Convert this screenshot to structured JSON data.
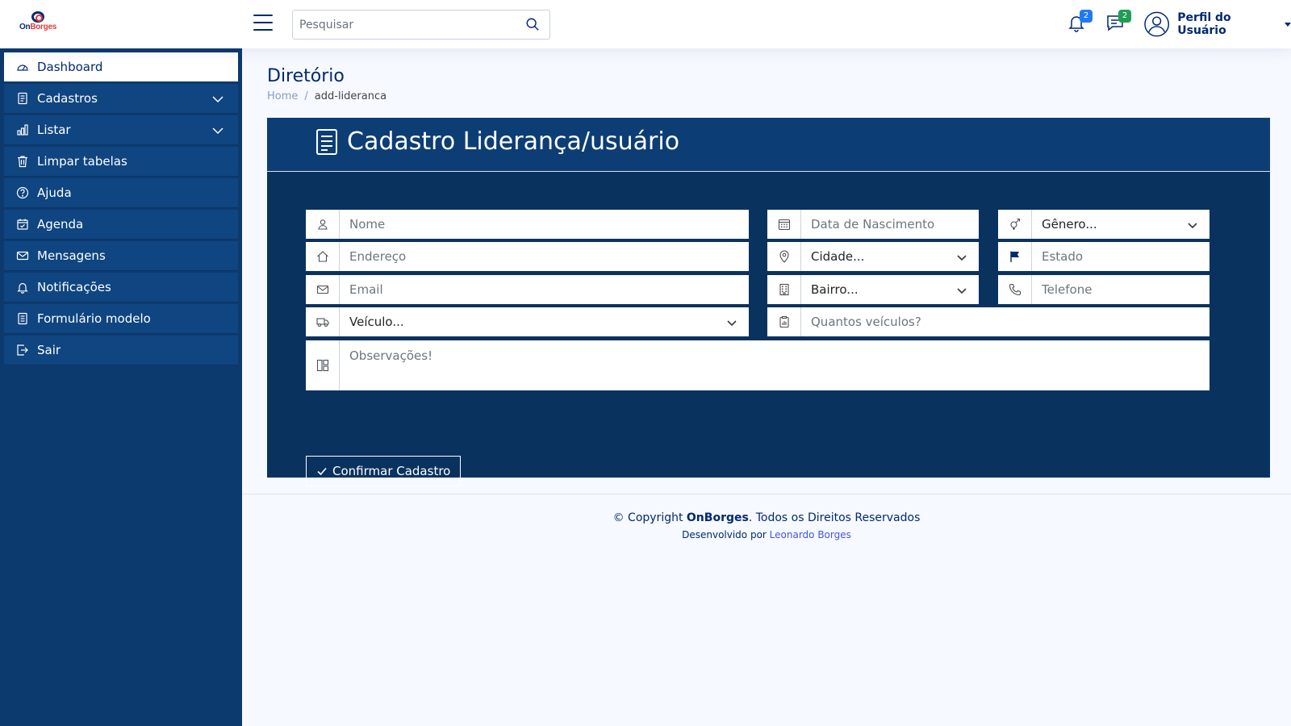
{
  "header": {
    "logo": {
      "brand_on": "On",
      "brand_borges": "Borges"
    },
    "search_placeholder": "Pesquisar",
    "notifications_count": "2",
    "messages_count": "2",
    "profile_label": "Perfil do Usuário"
  },
  "sidebar": {
    "items": [
      {
        "label": "Dashboard",
        "icon": "speedometer-icon"
      },
      {
        "label": "Cadastros",
        "icon": "journal-icon"
      },
      {
        "label": "Listar",
        "icon": "bar-chart-icon"
      },
      {
        "label": "Limpar tabelas",
        "icon": "trash-icon"
      },
      {
        "label": "Ajuda",
        "icon": "question-circle-icon"
      },
      {
        "label": "Agenda",
        "icon": "calendar-check-icon"
      },
      {
        "label": "Mensagens",
        "icon": "envelope-icon"
      },
      {
        "label": "Notificações",
        "icon": "bell-icon"
      },
      {
        "label": "Formulário modelo",
        "icon": "file-text-icon"
      },
      {
        "label": "Sair",
        "icon": "box-arrow-right-icon"
      }
    ]
  },
  "page": {
    "title": "Diretório",
    "breadcrumb": {
      "home": "Home",
      "current": "add-lideranca"
    }
  },
  "form": {
    "title": "Cadastro Liderança/usuário",
    "fields": {
      "nome": "Nome",
      "data_nascimento": "Data de Nascimento",
      "genero": "Gênero...",
      "endereco": "Endereço",
      "cidade": "Cidade...",
      "estado": "Estado",
      "email": "Email",
      "bairro": "Bairro...",
      "telefone": "Telefone",
      "veiculo": "Veículo...",
      "quantos_veiculos": "Quantos veículos?",
      "observacoes": "Observações!"
    },
    "submit_label": "Confirmar Cadastro"
  },
  "footer": {
    "copyright_prefix": "© Copyright ",
    "brand": "OnBorges",
    "copyright_suffix": ". Todos os Direitos Reservados",
    "developed_by": "Desenvolvido por ",
    "developer": "Leonardo Borges"
  },
  "colors": {
    "sidebar_bg": "#0d3a6e",
    "card_bg": "#0a325e",
    "text_primary": "#012970",
    "badge_blue": "#1e7bf2",
    "badge_green": "#1f9d55"
  }
}
